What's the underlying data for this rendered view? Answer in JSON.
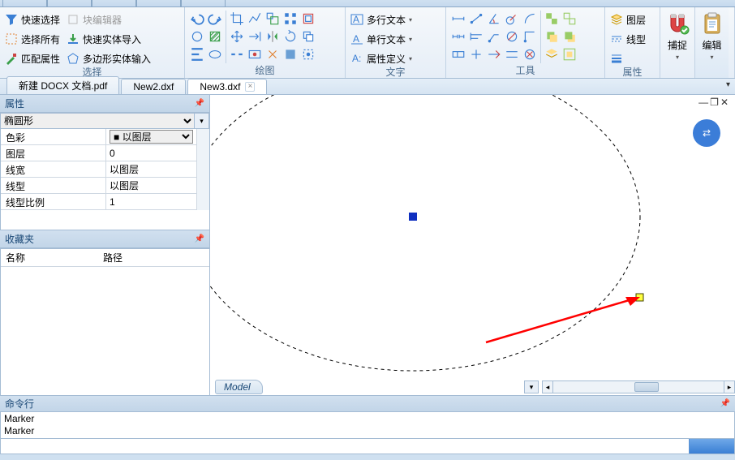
{
  "ribbon": {
    "select": {
      "label": "选择",
      "items": [
        {
          "label": "快速选择"
        },
        {
          "label": "选择所有"
        },
        {
          "label": "匹配属性"
        }
      ],
      "items2": [
        {
          "label": "块编辑器"
        },
        {
          "label": "快速实体导入"
        },
        {
          "label": "多边形实体输入"
        }
      ]
    },
    "draw": {
      "label": "绘图"
    },
    "text": {
      "label": "文字",
      "items": [
        {
          "label": "多行文本"
        },
        {
          "label": "单行文本"
        },
        {
          "label": "属性定义"
        }
      ]
    },
    "tools": {
      "label": "工具"
    },
    "props": {
      "label": "属性",
      "items": [
        {
          "label": "图层"
        },
        {
          "label": "线型"
        }
      ]
    },
    "snap": {
      "label": "捕捉"
    },
    "edit": {
      "label": "编辑"
    }
  },
  "doc_tabs": [
    {
      "label": "新建 DOCX 文档.pdf",
      "active": false
    },
    {
      "label": "New2.dxf",
      "active": false
    },
    {
      "label": "New3.dxf",
      "active": true
    }
  ],
  "properties_panel": {
    "title": "属性",
    "shape": "椭圆形",
    "rows": [
      {
        "k": "色彩",
        "v": "以图层",
        "swatch": true,
        "dropdown": true
      },
      {
        "k": "图层",
        "v": "0"
      },
      {
        "k": "线宽",
        "v": "以图层"
      },
      {
        "k": "线型",
        "v": "以图层"
      },
      {
        "k": "线型比例",
        "v": "1"
      }
    ]
  },
  "favorites_panel": {
    "title": "收藏夹",
    "cols": [
      "名称",
      "路径"
    ]
  },
  "model_tab": "Model",
  "command_line": {
    "title": "命令行",
    "output": [
      "Marker",
      "Marker"
    ],
    "input": ""
  }
}
